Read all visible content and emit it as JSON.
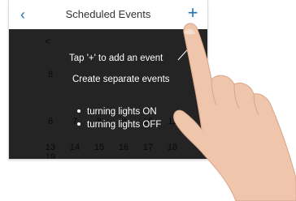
{
  "header": {
    "back_icon": "chevron-left-icon",
    "back_glyph": "‹",
    "title": "Scheduled Events",
    "add_icon": "plus-icon",
    "add_glyph": "+"
  },
  "calendar": {
    "prev_glyph": "<",
    "month_label": "",
    "row_a": [
      "8",
      "",
      "",
      "",
      "",
      "",
      ""
    ],
    "row_b": [
      "",
      "",
      "",
      "",
      "",
      "",
      ""
    ],
    "row_c": [
      "6",
      "7",
      "8",
      "9",
      "10",
      "11",
      ""
    ],
    "row_d": [
      "13",
      "14",
      "15",
      "16",
      "17",
      "18",
      "19"
    ]
  },
  "tooltip": {
    "line1": "Tap '+' to add an event",
    "line2": "Create separate events",
    "bullets": [
      "turning lights ON",
      "turning lights OFF"
    ]
  },
  "colors": {
    "accent": "#1f73b7",
    "overlay": "#1e1e1e",
    "skin": "#efc5ab"
  }
}
